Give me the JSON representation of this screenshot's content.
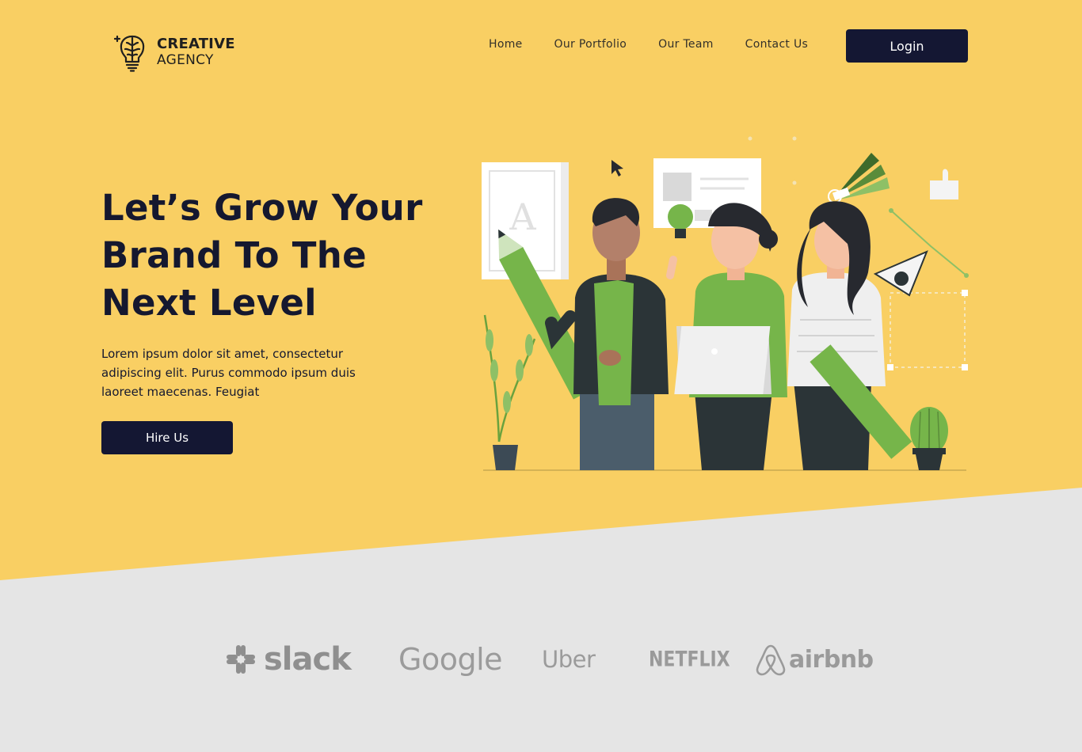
{
  "brand": {
    "name_line1": "CREATIVE",
    "name_line2": "AGENCY",
    "logo_icon": "brain-lightbulb-icon"
  },
  "nav": {
    "items": [
      {
        "label": "Home"
      },
      {
        "label": "Our Portfolio"
      },
      {
        "label": "Our Team"
      },
      {
        "label": "Contact Us"
      }
    ],
    "login_label": "Login"
  },
  "hero": {
    "title": "Let’s Grow Your Brand To The Next Level",
    "description": "Lorem ipsum dolor sit amet, consectetur adipiscing elit. Purus commodo ipsum duis laoreet maecenas. Feugiat",
    "cta_label": "Hire Us",
    "illustration": "creative-team-illustration"
  },
  "partners": [
    {
      "name": "slack",
      "icon": "slack-icon"
    },
    {
      "name": "Google"
    },
    {
      "name": "Uber"
    },
    {
      "name": "NETFLIX"
    },
    {
      "name": "airbnb",
      "icon": "airbnb-icon"
    }
  ],
  "colors": {
    "hero_background": "#f9cf63",
    "lower_background": "#e5e5e5",
    "button_background": "#141733",
    "text_dark": "#15182f",
    "illustration_green": "#76b54a",
    "illustration_dark": "#2b3437",
    "logo_gray": "#9a9a9a"
  }
}
